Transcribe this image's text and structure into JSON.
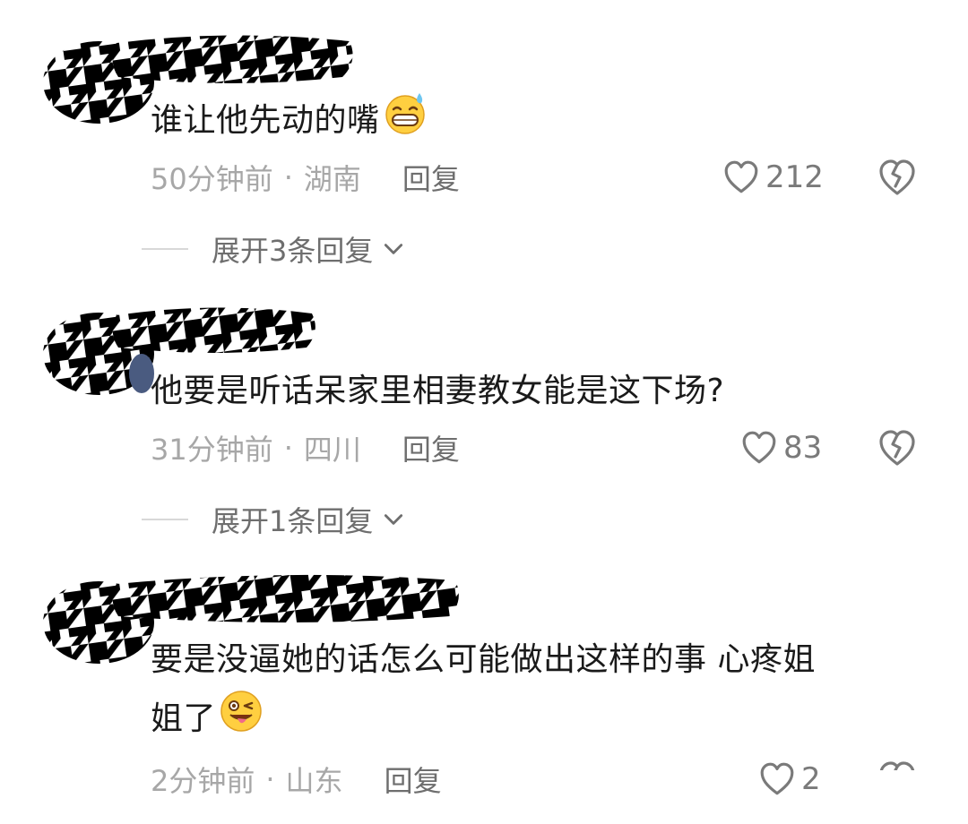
{
  "comments": [
    {
      "text": "谁让他先动的嘴",
      "emoji": "grinning-sweat-emoji",
      "time": "50分钟前",
      "separator": "·",
      "location": "湖南",
      "reply_label": "回复",
      "likes": "212",
      "expand_label": "展开3条回复"
    },
    {
      "text": "他要是听话呆家里相妻教女能是这下场?",
      "time": "31分钟前",
      "separator": "·",
      "location": "四川",
      "reply_label": "回复",
      "likes": "83",
      "expand_label": "展开1条回复"
    },
    {
      "text_line1": "要是没逼她的话怎么可能做出这样的事 心疼姐",
      "text_line2": "姐了",
      "emoji": "winking-tongue-emoji",
      "time": "2分钟前",
      "separator": "·",
      "location": "山东",
      "reply_label": "回复",
      "likes": "2"
    }
  ],
  "icons": {
    "like": "heart-outline-icon",
    "dislike": "broken-heart-icon",
    "expand": "chevron-down-icon"
  },
  "colors": {
    "text": "#1a1a1a",
    "meta": "#a7a7a7",
    "reply": "#6e6e6e",
    "mask": "#000000"
  }
}
